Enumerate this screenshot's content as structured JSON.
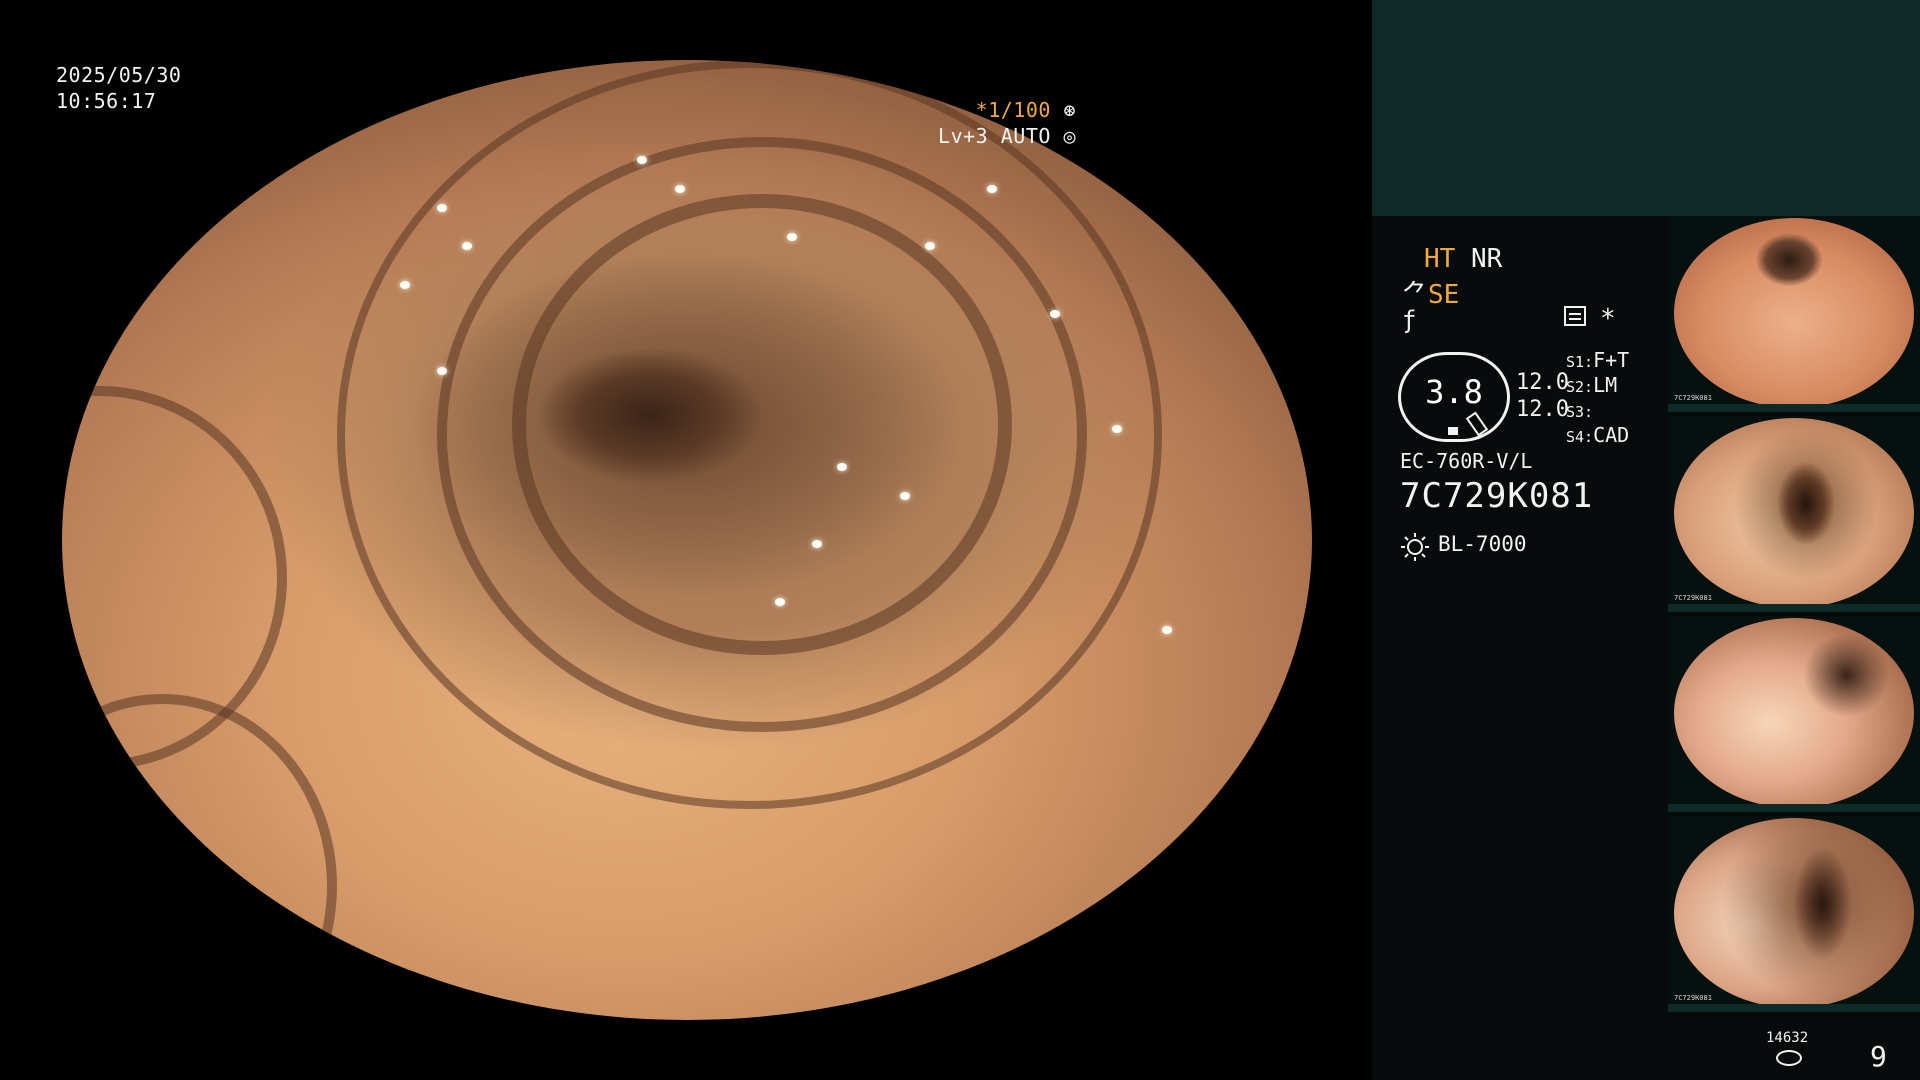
{
  "osd": {
    "date": "2025/05/30",
    "time": "10:56:17",
    "shutter": "*1/100",
    "level": "Lv+3 AUTO"
  },
  "panel": {
    "mode_ht": "HT",
    "mode_nr": "NR",
    "mode_se": "SE",
    "gauge_value": "3.8",
    "gauge_num_1": "12.0",
    "gauge_num_2": "12.0",
    "s_settings": [
      {
        "key": "S1:",
        "value": "F+T"
      },
      {
        "key": "S2:",
        "value": "LM"
      },
      {
        "key": "S3:",
        "value": ""
      },
      {
        "key": "S4:",
        "value": "CAD"
      }
    ],
    "scope_model": "EC-760R-V/L",
    "scope_serial": "7C729K081",
    "light_source": "BL-7000",
    "storage_count": "14632",
    "page_number": "9"
  },
  "thumbnails": [
    {
      "caption": "7C729K081"
    },
    {
      "caption": "7C729K081"
    },
    {
      "caption": ""
    },
    {
      "caption": "7C729K081"
    }
  ],
  "colors": {
    "accent_orange": "#f2a938",
    "panel_band": "#0d2a29",
    "panel_bg": "#070b0b"
  },
  "icons": [
    "shutter-icon",
    "auto-iris-icon",
    "structure-enhance-icon",
    "fnumber-icon",
    "list-icon",
    "asterisk-icon",
    "light-bulb-icon",
    "storage-icon"
  ]
}
